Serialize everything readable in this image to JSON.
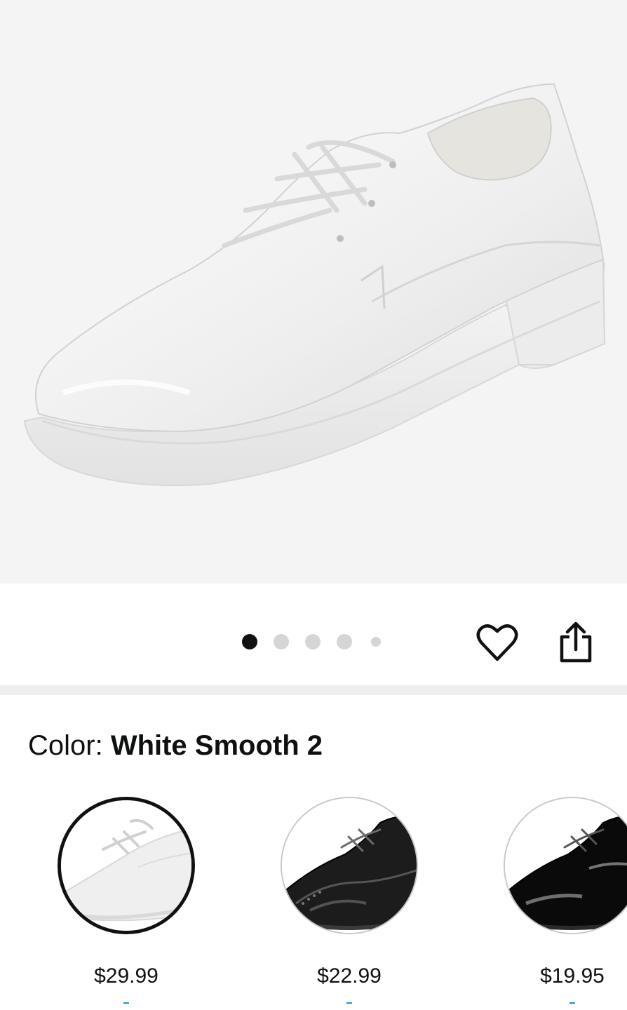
{
  "hero": {
    "image_alt": "White smooth lace-up oxford dress shoe"
  },
  "carousel": {
    "dot_count": 5,
    "active_index": 0
  },
  "actions": {
    "favorite_icon": "heart-icon",
    "share_icon": "share-icon"
  },
  "color": {
    "label": "Color: ",
    "selected_value": "White Smooth 2"
  },
  "swatches": [
    {
      "name": "white-smooth",
      "price": "$29.99",
      "selected": true,
      "color": "#f2f2f2"
    },
    {
      "name": "black-smooth",
      "price": "$22.99",
      "selected": false,
      "color": "#1a1a1a"
    },
    {
      "name": "black-patent",
      "price": "$19.95",
      "selected": false,
      "color": "#0a0a0a"
    }
  ],
  "colors": {
    "accent_link": "#2a8cc4",
    "selected_border": "#111111"
  }
}
